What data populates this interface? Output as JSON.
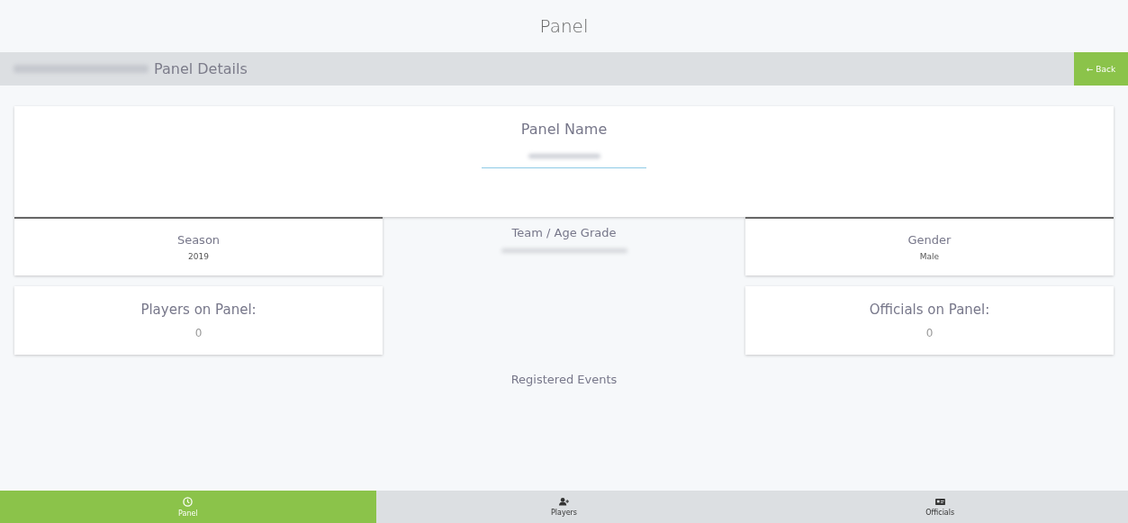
{
  "page_title": "Panel",
  "header": {
    "title": "Panel Details",
    "back_button": {
      "icon": "←",
      "label": "Back"
    }
  },
  "panel_name": {
    "label": "Panel Name"
  },
  "details": [
    {
      "label": "Season",
      "value": "2019",
      "kind": "card"
    },
    {
      "label": "Team / Age Grade",
      "kind": "plain"
    },
    {
      "label": "Gender",
      "value": "Male",
      "kind": "card"
    }
  ],
  "counts": [
    {
      "label": "Players on Panel:",
      "value": "0"
    },
    {
      "label": "Officials on Panel:",
      "value": "0"
    }
  ],
  "events_heading": "Registered Events",
  "tabs": [
    {
      "label": "Panel",
      "selected": true
    },
    {
      "label": "Players",
      "selected": false
    },
    {
      "label": "Officials",
      "selected": false
    }
  ]
}
